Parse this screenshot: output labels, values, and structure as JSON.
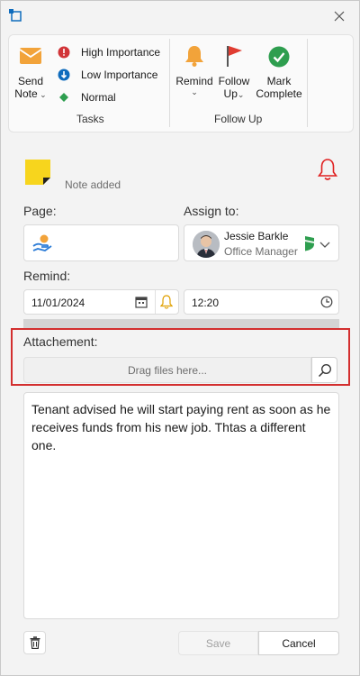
{
  "ribbon": {
    "send_note": {
      "line1": "Send",
      "line2": "Note",
      "icon": "envelope-icon"
    },
    "importance": [
      {
        "label": "High Importance",
        "icon": "high-importance-icon",
        "color": "#d13438"
      },
      {
        "label": "Low Importance",
        "icon": "low-importance-icon",
        "color": "#0f6cbd"
      },
      {
        "label": "Normal",
        "icon": "normal-diamond-icon",
        "color": "#2e9e4f"
      }
    ],
    "tasks_group_label": "Tasks",
    "remind": {
      "label": "Remind",
      "icon": "bell-icon",
      "color": "#f2a33a"
    },
    "follow_up": {
      "line1": "Follow",
      "line2": "Up",
      "icon": "flag-icon",
      "color": "#e03c31"
    },
    "mark_complete": {
      "line1": "Mark",
      "line2": "Complete",
      "icon": "checkmark-circle-icon",
      "color": "#2e9e4f"
    },
    "follow_up_group_label": "Follow Up"
  },
  "note": {
    "status": "Note added",
    "icon": "sticky-note-icon",
    "alarm_icon": "alarm-bell-icon"
  },
  "page_field": {
    "label": "Page:",
    "icon": "hand-coin-icon"
  },
  "assign_field": {
    "label": "Assign to:",
    "name": "Jessie Barkle",
    "role": "Office Manager",
    "status_color": "#2e9e4f"
  },
  "remind_field": {
    "label": "Remind:",
    "date": "11/01/2024",
    "time": "12:20"
  },
  "attachment": {
    "label": "Attachement:",
    "placeholder": "Drag files here..."
  },
  "body_text": "Tenant advised he will start paying rent as soon as he receives funds from his new job. Thtas a different one.",
  "footer": {
    "save": "Save",
    "cancel": "Cancel"
  },
  "colors": {
    "accent": "#0f6cbd",
    "highlight_border": "#d32f2f"
  }
}
